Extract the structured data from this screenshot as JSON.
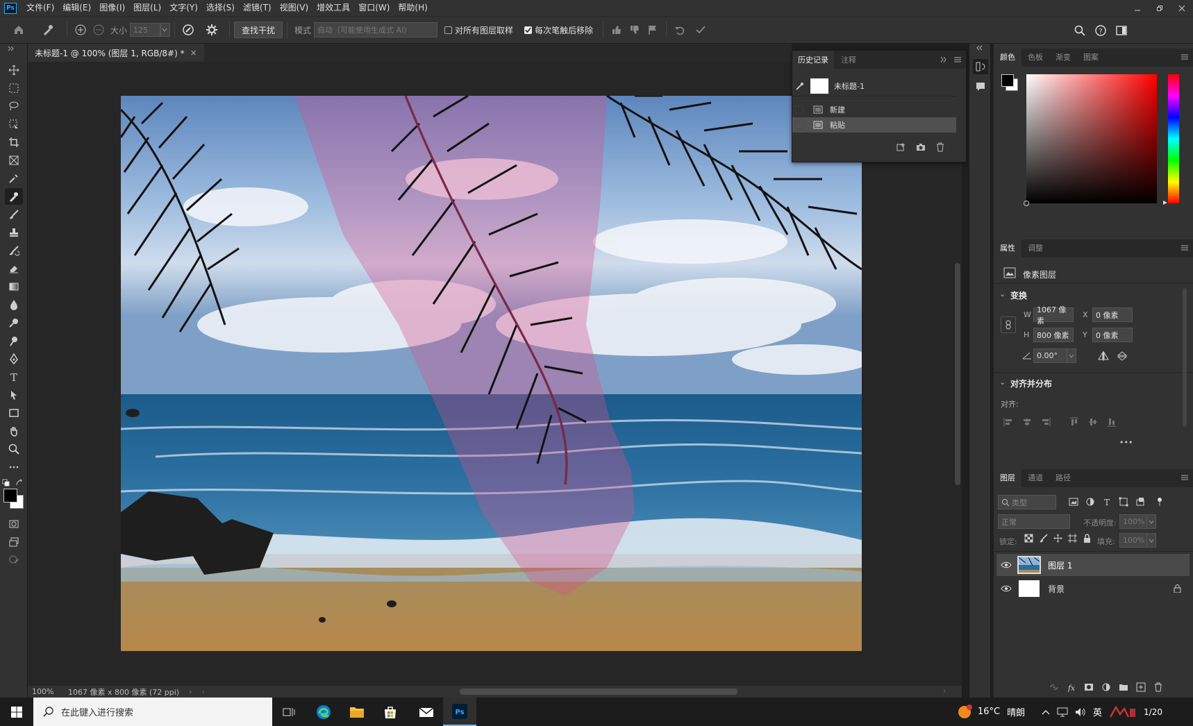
{
  "app": {
    "logo": "Ps"
  },
  "menu": [
    "文件(F)",
    "编辑(E)",
    "图像(I)",
    "图层(L)",
    "文字(Y)",
    "选择(S)",
    "滤镜(T)",
    "视图(V)",
    "增效工具",
    "窗口(W)",
    "帮助(H)"
  ],
  "options": {
    "size_label": "大小",
    "size_value": "125",
    "find_interference": "查找干扰",
    "mode_label": "模式",
    "mode_value": "自动（可能使用生成式 AI）",
    "sample_all_layers": "对所有图层取样",
    "remove_after_stroke": "每次笔触后移除"
  },
  "document": {
    "tab_title": "未标题-1 @ 100% (图层 1, RGB/8#) *",
    "zoom": "100%",
    "doc_info": "1067 像素 x 800 像素 (72 ppi)"
  },
  "history": {
    "tabs": [
      "历史记录",
      "注释"
    ],
    "snapshot": "未标题-1",
    "items": [
      "新建",
      "粘贴"
    ]
  },
  "color_panel": {
    "tabs": [
      "颜色",
      "色板",
      "渐变",
      "图案"
    ],
    "hue_color": "#ff0000"
  },
  "properties": {
    "tabs": [
      "属性",
      "调整"
    ],
    "type": "像素图层",
    "transform_title": "变换",
    "w_label": "W",
    "w_value": "1067 像素",
    "h_label": "H",
    "h_value": "800 像素",
    "x_label": "X",
    "x_value": "0 像素",
    "y_label": "Y",
    "y_value": "0 像素",
    "angle_value": "0.00°",
    "align_title": "对齐并分布",
    "align_label": "对齐:",
    "more": "•••"
  },
  "layers": {
    "tabs": [
      "图层",
      "通道",
      "路径"
    ],
    "filter_placeholder": "类型",
    "blend_mode": "正常",
    "opacity_label": "不透明度:",
    "opacity_value": "100%",
    "lock_label": "锁定:",
    "fill_label": "填充:",
    "fill_value": "100%",
    "items": [
      {
        "name": "图层 1",
        "selected": true
      },
      {
        "name": "背景",
        "selected": false
      }
    ]
  },
  "taskbar": {
    "search_placeholder": "在此键入进行搜索",
    "weather_temp": "16°C",
    "weather_text": "晴朗",
    "ime": "英",
    "time": "1/20"
  }
}
